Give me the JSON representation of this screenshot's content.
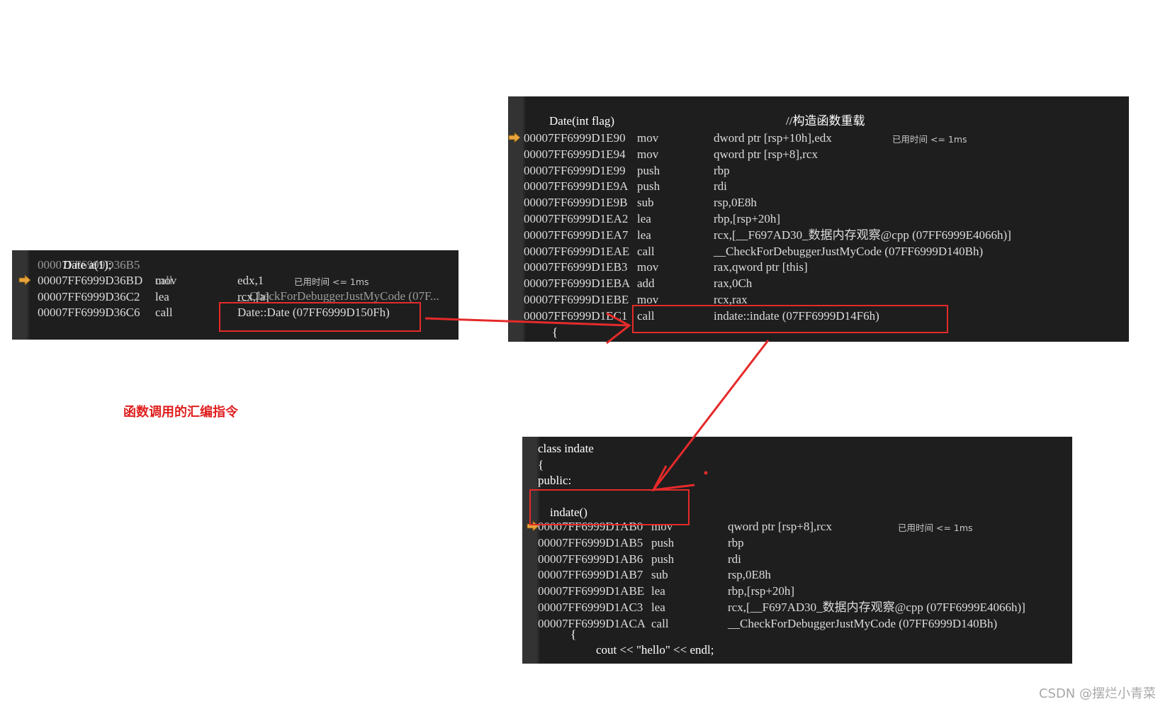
{
  "panel1": {
    "cut_line": {
      "addr": "00007FF6999D36B5",
      "op": "call",
      "arg": "__CheckForDebuggerJustMyCode (07F..."
    },
    "source": "Date a(1);",
    "rows": [
      {
        "addr": "00007FF6999D36BD",
        "op": "mov",
        "arg": "edx,1",
        "elapsed": "已用时间 <= 1ms"
      },
      {
        "addr": "00007FF6999D36C2",
        "op": "lea",
        "arg": "rcx,[a]"
      },
      {
        "addr": "00007FF6999D36C6",
        "op": "call",
        "arg": "Date::Date (07FF6999D150Fh)"
      }
    ]
  },
  "panel2": {
    "source": "Date(int flag)",
    "comment": "//构造函数重载",
    "rows": [
      {
        "addr": "00007FF6999D1E90",
        "op": "mov",
        "arg": "dword ptr [rsp+10h],edx",
        "elapsed": "已用时间 <= 1ms"
      },
      {
        "addr": "00007FF6999D1E94",
        "op": "mov",
        "arg": "qword ptr [rsp+8],rcx"
      },
      {
        "addr": "00007FF6999D1E99",
        "op": "push",
        "arg": "rbp"
      },
      {
        "addr": "00007FF6999D1E9A",
        "op": "push",
        "arg": "rdi"
      },
      {
        "addr": "00007FF6999D1E9B",
        "op": "sub",
        "arg": "rsp,0E8h"
      },
      {
        "addr": "00007FF6999D1EA2",
        "op": "lea",
        "arg": "rbp,[rsp+20h]"
      },
      {
        "addr": "00007FF6999D1EA7",
        "op": "lea",
        "arg": "rcx,[__F697AD30_数据内存观察@cpp (07FF6999E4066h)]"
      },
      {
        "addr": "00007FF6999D1EAE",
        "op": "call",
        "arg": "__CheckForDebuggerJustMyCode (07FF6999D140Bh)"
      },
      {
        "addr": "00007FF6999D1EB3",
        "op": "mov",
        "arg": "rax,qword ptr [this]"
      },
      {
        "addr": "00007FF6999D1EBA",
        "op": "add",
        "arg": "rax,0Ch"
      },
      {
        "addr": "00007FF6999D1EBE",
        "op": "mov",
        "arg": "rcx,rax"
      },
      {
        "addr": "00007FF6999D1EC1",
        "op": "call",
        "arg": "indate::indate (07FF6999D14F6h)"
      }
    ],
    "brace": "{"
  },
  "panel3": {
    "source_lines": [
      "class indate",
      "{",
      "public:",
      "",
      "    indate()"
    ],
    "rows": [
      {
        "addr": "00007FF6999D1AB0",
        "op": "mov",
        "arg": "qword ptr [rsp+8],rcx",
        "elapsed": "已用时间 <= 1ms"
      },
      {
        "addr": "00007FF6999D1AB5",
        "op": "push",
        "arg": "rbp"
      },
      {
        "addr": "00007FF6999D1AB6",
        "op": "push",
        "arg": "rdi"
      },
      {
        "addr": "00007FF6999D1AB7",
        "op": "sub",
        "arg": "rsp,0E8h"
      },
      {
        "addr": "00007FF6999D1ABE",
        "op": "lea",
        "arg": "rbp,[rsp+20h]"
      },
      {
        "addr": "00007FF6999D1AC3",
        "op": "lea",
        "arg": "rcx,[__F697AD30_数据内存观察@cpp (07FF6999E4066h)]"
      },
      {
        "addr": "00007FF6999D1ACA",
        "op": "call",
        "arg": "__CheckForDebuggerJustMyCode (07FF6999D140Bh)"
      }
    ],
    "brace": "{",
    "cout_line": "cout << \"hello\" << endl;"
  },
  "caption": "函数调用的汇编指令",
  "watermark": "CSDN @摆烂小青菜",
  "colors": {
    "annotation_red": "#e52a2a",
    "editor_bg": "#1e1e1e",
    "arrow_indicator": "#e8a33b"
  }
}
